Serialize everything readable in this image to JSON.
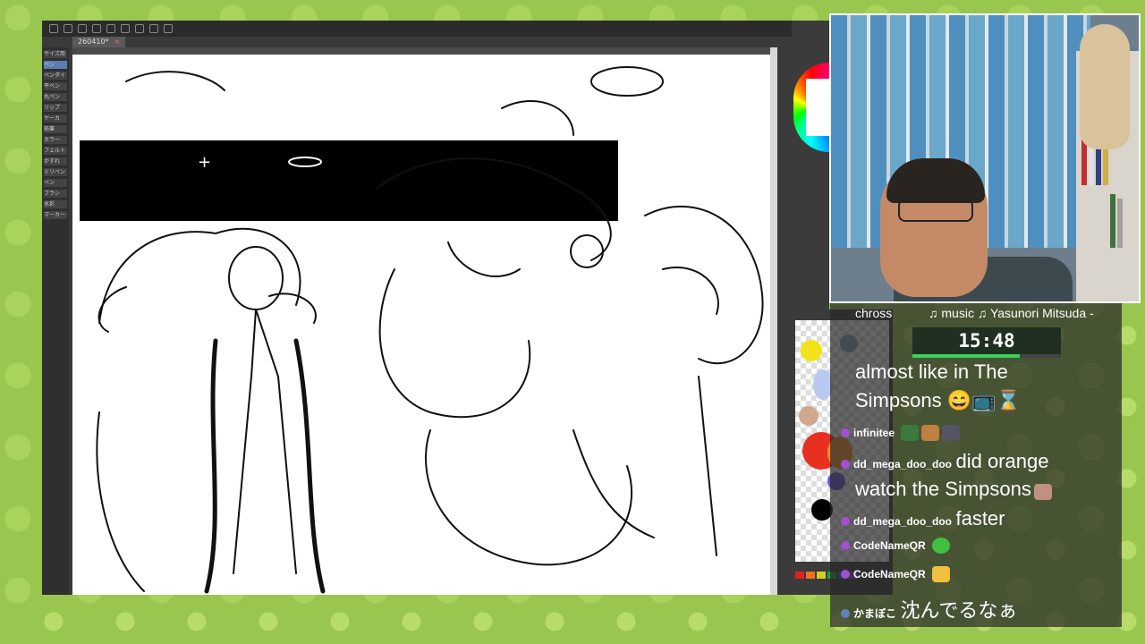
{
  "app": {
    "doc_tab_label": "260410*",
    "left_panel_items": [
      "サイズ用",
      "ペン",
      "ペンダイ",
      "平ペン",
      "丸ペン",
      "リップ",
      "ヤーカ",
      "鉛筆",
      "カラー",
      "フェルト",
      "かすれ",
      "ミリペン",
      "ペン",
      "ブラシ",
      "水彩",
      "マーカー"
    ]
  },
  "stream": {
    "song_left": "chross",
    "song_right": "♫ music ♫ Yasunori Mitsuda -",
    "timer": "15:48",
    "timer_progress": 0.72
  },
  "chat": {
    "messages": [
      {
        "user": "",
        "text": "almost like in The"
      },
      {
        "user": "",
        "text": "Simpsons 😄📺⌛"
      },
      {
        "user": "infinitee",
        "text": ""
      },
      {
        "user": "dd_mega_doo_doo",
        "text": "did orange"
      },
      {
        "user": "",
        "text": "watch the Simpsons"
      },
      {
        "user": "dd_mega_doo_doo",
        "text": "faster"
      },
      {
        "user": "CodeNameQR",
        "text": ""
      },
      {
        "user": "CodeNameQR",
        "text": ""
      },
      {
        "user": "かまぼこ",
        "text": "沈んでるなぁ"
      }
    ]
  },
  "colors": {
    "accent_green": "#3cd060",
    "chat_badge": "#a050d0",
    "background_green": "#98c64f"
  }
}
